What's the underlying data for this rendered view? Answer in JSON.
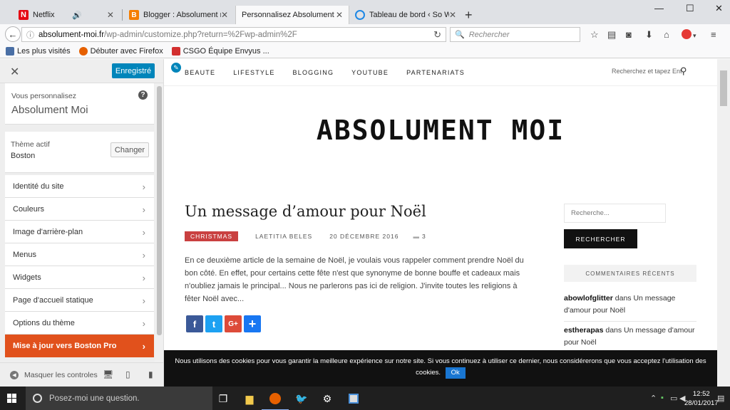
{
  "browser": {
    "tabs": [
      {
        "title": "Netflix",
        "favicon_color": "#e50914",
        "audio": true
      },
      {
        "title": "Blogger : Absolument moi...",
        "favicon_color": "#f57d00"
      },
      {
        "title": "Personnalisez Absolument Mo...",
        "favicon_color": "#f9f9fa",
        "active": true
      },
      {
        "title": "Tableau de bord ‹ So Wor...",
        "favicon_color": "#1e88e5"
      }
    ],
    "url_host": "absolument-moi.fr",
    "url_path": "/wp-admin/customize.php?return=%2Fwp-admin%2F",
    "search_placeholder": "Rechercher",
    "bookmarks": [
      {
        "label": "Les plus visités",
        "color": "#4a6fa5"
      },
      {
        "label": "Débuter avec Firefox",
        "color": "#e66000"
      },
      {
        "label": "CSGO Équipe Envyus ...",
        "color": "#d32f2f"
      }
    ]
  },
  "customizer": {
    "save_label": "Enregistré",
    "customizing_label": "Vous personnalisez",
    "site_name": "Absolument Moi",
    "active_theme_label": "Thème actif",
    "theme_name": "Boston",
    "change_label": "Changer",
    "menu": [
      {
        "label": "Identité du site"
      },
      {
        "label": "Couleurs"
      },
      {
        "label": "Image d'arrière-plan"
      },
      {
        "label": "Menus"
      },
      {
        "label": "Widgets"
      },
      {
        "label": "Page d'accueil statique"
      },
      {
        "label": "Options du thème"
      },
      {
        "label": "Mise à jour vers Boston Pro"
      }
    ],
    "hide_controls_label": "Masquer les controles"
  },
  "site": {
    "nav": [
      "BEAUTE",
      "LIFESTYLE",
      "BLOGGING",
      "YOUTUBE",
      "PARTENARIATS"
    ],
    "nav_search_placeholder": "Recherchez et tapez Ent",
    "logo": "ABSOLUMENT MOI",
    "post": {
      "title": "Un message d’amour pour Noël",
      "category": "CHRISTMAS",
      "author": "LAETITIA BELES",
      "date": "20 DÉCEMBRE 2016",
      "comments": "3",
      "excerpt": "En ce deuxième article de la semaine de Noël, je voulais vous rappeler comment prendre Noël du bon côté. En effet, pour certains cette fête n'est que synonyme de bonne bouffe et cadeaux mais n'oubliez jamais le principal... Nous ne parlerons pas ici de religion. J'invite toutes les religions à fêter Noël avec..."
    },
    "sidebar": {
      "search_placeholder": "Recherche...",
      "search_button": "RECHERCHER",
      "recent_comments_title": "COMMENTAIRES RÉCENTS",
      "comments": [
        {
          "author": "abowlofglitter",
          "text": " dans Un message d'amour pour Noël"
        },
        {
          "author": "estherapas",
          "text": " dans Un message d'amour pour Noël"
        }
      ]
    },
    "cookie_text": "Nous utilisons des cookies pour vous garantir la meilleure expérience sur notre site. Si vous continuez à utiliser ce dernier, nous considérerons que vous acceptez l'utilisation des cookies.",
    "cookie_ok": "Ok",
    "share_colors": {
      "facebook": "#3b5998",
      "twitter": "#1da1f2",
      "google": "#dd4b39",
      "share": "#1877f2"
    }
  },
  "taskbar": {
    "search_placeholder": "Posez-moi une question.",
    "time": "12:52",
    "date": "28/01/2017"
  }
}
